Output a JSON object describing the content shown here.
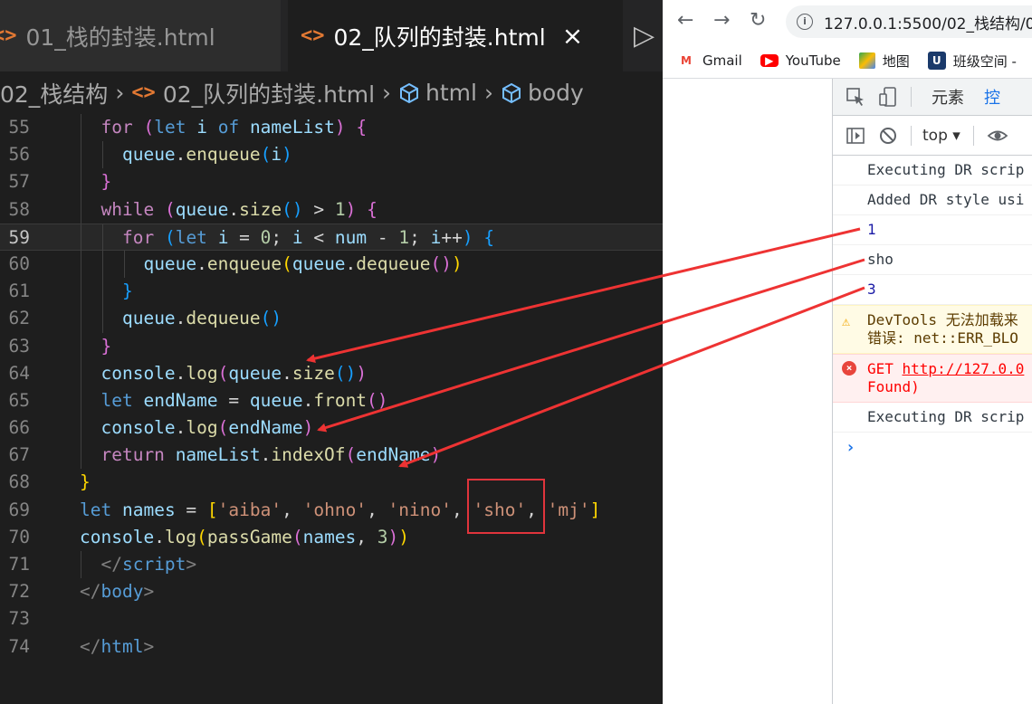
{
  "editor": {
    "tabs": [
      {
        "label": "01_栈的封装.html",
        "active": false
      },
      {
        "label": "02_队列的封装.html",
        "active": true
      }
    ],
    "tab_close": "×",
    "tab_more": "▷",
    "breadcrumb": [
      "02_栈结构",
      "02_队列的封装.html",
      "html",
      "body"
    ],
    "current_line": "59",
    "lines": [
      {
        "n": "55"
      },
      {
        "n": "56"
      },
      {
        "n": "57"
      },
      {
        "n": "58"
      },
      {
        "n": "59"
      },
      {
        "n": "60"
      },
      {
        "n": "61"
      },
      {
        "n": "62"
      },
      {
        "n": "63"
      },
      {
        "n": "64"
      },
      {
        "n": "65"
      },
      {
        "n": "66"
      },
      {
        "n": "67"
      },
      {
        "n": "68"
      },
      {
        "n": "69"
      },
      {
        "n": "70"
      },
      {
        "n": "71"
      },
      {
        "n": "72"
      },
      {
        "n": "73"
      },
      {
        "n": "74"
      }
    ],
    "highlight_text": "'sho'"
  },
  "browser": {
    "url": "127.0.0.1:5500/02_栈结构/02",
    "bookmarks": [
      "Gmail",
      "YouTube",
      "地图",
      "班级空间 -"
    ],
    "devtools_tabs": [
      "元素",
      "控"
    ],
    "context": "top",
    "console": [
      {
        "type": "log",
        "text": "Executing DR scrip"
      },
      {
        "type": "log",
        "text": "Added DR style usi"
      },
      {
        "type": "num",
        "text": "1"
      },
      {
        "type": "log",
        "text": "sho"
      },
      {
        "type": "num",
        "text": "3"
      },
      {
        "type": "warn",
        "text": "DevTools 无法加载来",
        "text2": "错误: net::ERR_BLO"
      },
      {
        "type": "err",
        "text_prefix": "GET ",
        "link": "http://127.0.0",
        "text2": "Found)"
      },
      {
        "type": "log",
        "text": "Executing DR scrip"
      }
    ],
    "prompt": "›"
  },
  "colors": {
    "editor_bg": "#1e1e1e",
    "keyword": "#569cd6",
    "variable": "#9cdcfe",
    "function": "#dcdcaa",
    "string": "#ce9178",
    "annotation_red": "#e0343c"
  }
}
